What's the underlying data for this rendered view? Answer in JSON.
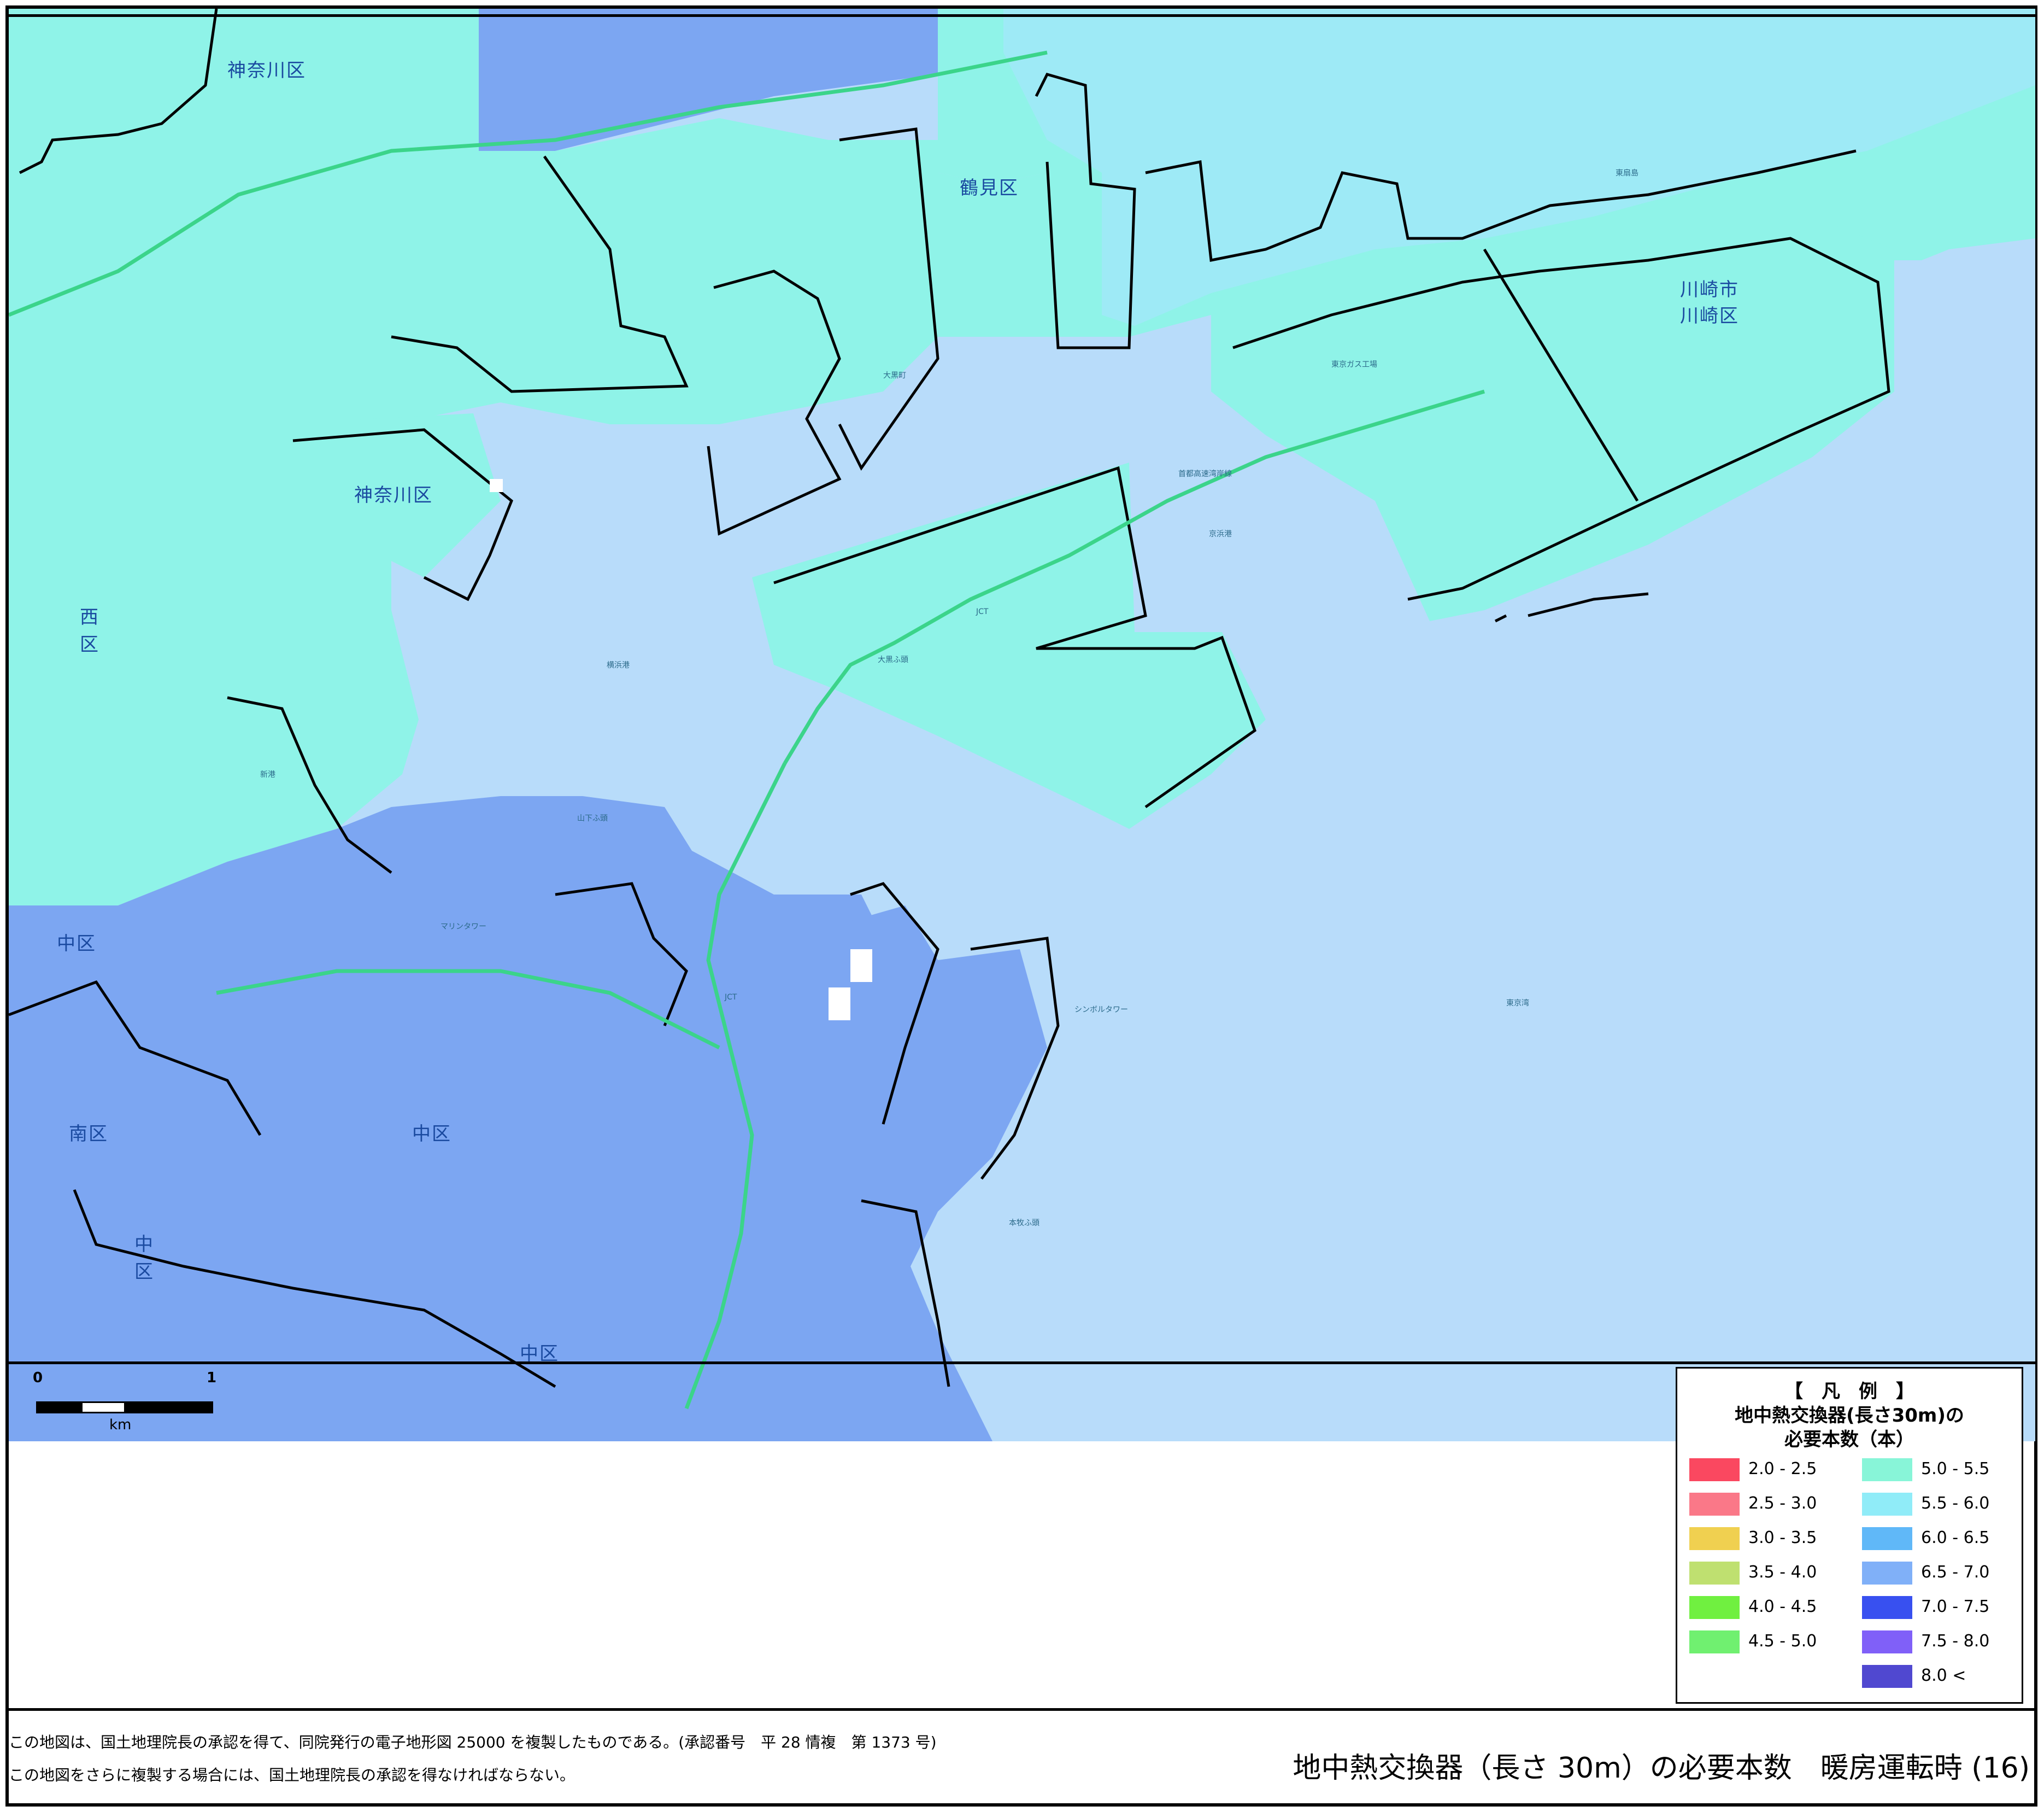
{
  "map": {
    "place_labels": [
      {
        "text": "神奈川区",
        "cls": "big"
      },
      {
        "text": "鶴見区",
        "cls": "big"
      },
      {
        "text": "神奈川区",
        "cls": "big"
      },
      {
        "text": "西",
        "cls": "big"
      },
      {
        "text": "区",
        "cls": "big"
      },
      {
        "text": "川崎市",
        "cls": "big"
      },
      {
        "text": "川崎区",
        "cls": "big"
      },
      {
        "text": "中区",
        "cls": "big"
      },
      {
        "text": "南区",
        "cls": "big"
      },
      {
        "text": "中区",
        "cls": "big"
      },
      {
        "text": "中",
        "cls": "big"
      },
      {
        "text": "区",
        "cls": "big"
      },
      {
        "text": "中区",
        "cls": "big"
      },
      {
        "text": "JCT",
        "cls": "small"
      },
      {
        "text": "JCT",
        "cls": "small"
      },
      {
        "text": "横浜港",
        "cls": "small"
      },
      {
        "text": "京浜港",
        "cls": "small"
      },
      {
        "text": "東京湾",
        "cls": "small"
      },
      {
        "text": "首都高速湾岸線",
        "cls": "small"
      },
      {
        "text": "マリンタワー",
        "cls": "small"
      },
      {
        "text": "シンボルタワー",
        "cls": "small"
      },
      {
        "text": "山下ふ頭",
        "cls": "small"
      },
      {
        "text": "新港",
        "cls": "small"
      },
      {
        "text": "大黒町",
        "cls": "small"
      },
      {
        "text": "東京ガス工場",
        "cls": "small"
      },
      {
        "text": "東扇島",
        "cls": "small"
      },
      {
        "text": "大黒ふ頭",
        "cls": "small"
      },
      {
        "text": "本牧ふ頭",
        "cls": "small"
      }
    ],
    "colors": {
      "sea": "#b8dcfa",
      "cyan_zone": "#8ff3e8",
      "lightblue_zone": "#9eeaf6",
      "blue_zone": "#7ca6f2",
      "border_line": "#000000",
      "road": "#3bd48a"
    }
  },
  "scale": {
    "zero": "0",
    "one": "1",
    "unit": "km"
  },
  "legend": {
    "bracket_title": "【　凡　例　】",
    "title_line1": "地中熱交換器(長さ30m)の",
    "title_line2": "必要本数（本）",
    "items": [
      {
        "label": "2.0 - 2.5",
        "color": "#fa4860"
      },
      {
        "label": "2.5 - 3.0",
        "color": "#fa7888"
      },
      {
        "label": "3.0 - 3.5",
        "color": "#f0d050"
      },
      {
        "label": "3.5 - 4.0",
        "color": "#bfe070"
      },
      {
        "label": "4.0 - 4.5",
        "color": "#70f040"
      },
      {
        "label": "4.5 - 5.0",
        "color": "#70f070"
      },
      {
        "label": "5.0 - 5.5",
        "color": "#88f5d8"
      },
      {
        "label": "5.5 - 6.0",
        "color": "#90ecf8"
      },
      {
        "label": "6.0 - 6.5",
        "color": "#60b8f8"
      },
      {
        "label": "6.5 - 7.0",
        "color": "#80b0f8"
      },
      {
        "label": "7.0 - 7.5",
        "color": "#3850f0"
      },
      {
        "label": "7.5 - 8.0",
        "color": "#8060f8"
      },
      {
        "label": "8.0 <",
        "color": "#5048d0"
      }
    ]
  },
  "footer": {
    "note1": "この地図は、国土地理院長の承認を得て、同院発行の電子地形図 25000 を複製したものである。(承認番号　平 28 情複　第 1373 号)",
    "note2": "この地図をさらに複製する場合には、国土地理院長の承認を得なければならない。",
    "caption": "地中熱交換器（長さ 30m）の必要本数　暖房運転時 (16)"
  }
}
